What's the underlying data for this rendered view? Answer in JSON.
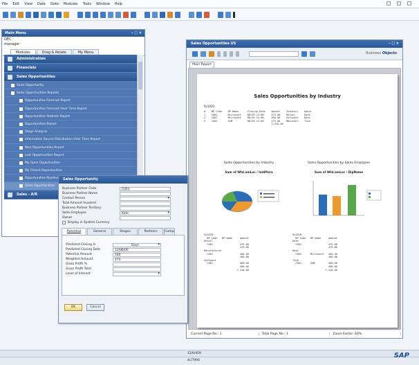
{
  "menubar": {
    "items": [
      "File",
      "Edit",
      "View",
      "Data",
      "Goto",
      "Modules",
      "Tools",
      "Window",
      "Help"
    ]
  },
  "main_menu": {
    "title": "Main Menu",
    "company": "OEC",
    "user": "manager",
    "tabs": [
      "Modules",
      "Drag & Relate",
      "My Menu"
    ],
    "modules": [
      {
        "label": "Administration",
        "icon": "gear-icon"
      },
      {
        "label": "Financials",
        "icon": "chart-icon"
      },
      {
        "label": "Sales Opportunities",
        "icon": "arrows-icon"
      }
    ],
    "items": [
      {
        "label": "Sales Opportunity",
        "level": 1
      },
      {
        "label": "Sales Opportunities Reports",
        "level": 1
      },
      {
        "label": "Opportunities Forecast Report",
        "level": 2
      },
      {
        "label": "Opportunities Forecast Over Time Report",
        "level": 2
      },
      {
        "label": "Opportunities Statistic Report",
        "level": 2
      },
      {
        "label": "Opportunities Report",
        "level": 2
      },
      {
        "label": "Stage Analysis",
        "level": 2
      },
      {
        "label": "Information Source Distribution Over Time Report",
        "level": 2
      },
      {
        "label": "Won Opportunities Report",
        "level": 2
      },
      {
        "label": "Lost Opportunities Report",
        "level": 2
      },
      {
        "label": "My Open Opportunities",
        "level": 2
      },
      {
        "label": "My Closed Opportunities",
        "level": 2
      },
      {
        "label": "Opportunities Pipeline",
        "level": 2
      },
      {
        "label": "Sales Opportunities",
        "level": 2
      }
    ],
    "bottom_module": "Sales - A/R"
  },
  "sales_form": {
    "title": "Sales Opportunity",
    "fields": [
      {
        "label": "Business Partner Code",
        "value": "C001",
        "dropdown": false
      },
      {
        "label": "Business Partner Name",
        "value": "",
        "dropdown": false
      },
      {
        "label": "Contact Person",
        "value": "",
        "dropdown": true
      },
      {
        "label": "Total Amount Invoiced",
        "value": "",
        "dropdown": false
      },
      {
        "label": "Business Partner Territory",
        "value": "",
        "dropdown": false
      },
      {
        "label": "Sales Employee",
        "value": "Kate",
        "dropdown": true
      },
      {
        "label": "Owner",
        "value": "",
        "dropdown": false
      }
    ],
    "checkbox": "Display in System Currency",
    "tabs": [
      "Potential",
      "General",
      "Stages",
      "Partners",
      "Compe"
    ],
    "potential_fields": [
      {
        "label": "Predicted Closing In",
        "value": "Days",
        "dropdown": true
      },
      {
        "label": "Predicted Closing Date",
        "value": "12/06/00",
        "dropdown": false
      },
      {
        "label": "Potential Amount",
        "value": "500",
        "dropdown": false
      },
      {
        "label": "Weighted Amount",
        "value": "475",
        "dropdown": false
      },
      {
        "label": "Gross Profit %",
        "value": "",
        "dropdown": false
      },
      {
        "label": "Gross Profit Total",
        "value": "",
        "dropdown": false
      },
      {
        "label": "Level of Interest",
        "value": "",
        "dropdown": true
      }
    ],
    "ok_label": "OK",
    "cancel_label": "Cancel"
  },
  "report_window": {
    "title": "Sales Opportunities US",
    "brand_prefix": "Business",
    "brand": "Objects",
    "tab": "Main Report",
    "report_title": "Sales Opportunities by Industry",
    "section_code": "9v1020",
    "chart1_title": "Sales Opportunities by Industry",
    "chart1_sub": "Sum of Wtd.amLoc / Indiftera",
    "chart2_title": "Sales Opportunities by Sales Employee",
    "chart2_sub": "Sum of Wtd.amLoc / DipName",
    "status": {
      "current_page": "Current Page No.: 1",
      "total_page": "Total Page No.: 1",
      "zoom": "Zoom Factor: 60%"
    }
  },
  "bottom": {
    "line1": "12/6/459",
    "line2": "4c/7994"
  },
  "logo": "SAP"
}
